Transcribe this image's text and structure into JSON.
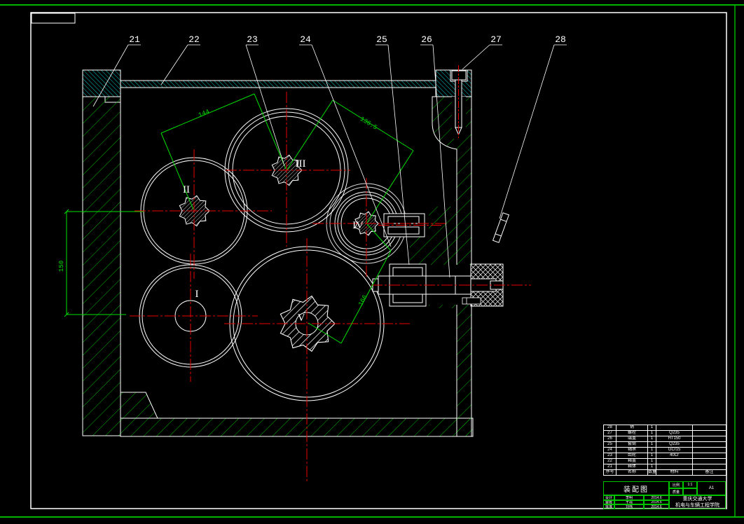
{
  "callouts": [
    "21",
    "22",
    "23",
    "24",
    "25",
    "26",
    "27",
    "28"
  ],
  "shafts": [
    "I",
    "II",
    "III",
    "IV",
    "V"
  ],
  "dimensions": {
    "vertical": "150",
    "upper": "144",
    "middle": "136.5",
    "lower": "166"
  },
  "colors": {
    "hatch_body": "#00b400",
    "hatch_cover": "#00c8c8",
    "centerline": "#e80000",
    "dimension": "#00e000",
    "line": "#ffffff",
    "table_green": "#00c400"
  },
  "bom": {
    "headers": [
      "序号",
      "名称",
      "数量",
      "材料",
      "备注"
    ],
    "rows": [
      [
        "28",
        "销",
        "1",
        "",
        ""
      ],
      [
        "27",
        "螺栓",
        "1",
        "Q235",
        ""
      ],
      [
        "26",
        "端盖",
        "1",
        "HT150",
        ""
      ],
      [
        "25",
        "套筒",
        "1",
        "Q235",
        ""
      ],
      [
        "24",
        "轴承",
        "1",
        "GCr15",
        ""
      ],
      [
        "23",
        "齿轮",
        "1",
        "40Cr",
        ""
      ],
      [
        "22",
        "箱盖",
        "1",
        "",
        ""
      ],
      [
        "21",
        "箱体",
        "1",
        "",
        ""
      ]
    ]
  },
  "title_block": {
    "drawing_title": "装配图",
    "scale_label": "比例",
    "scale_value": "1:1",
    "mass_label": "质量",
    "mass_value": "",
    "sheet_size": "A1",
    "sign_rows": [
      {
        "role": "设计",
        "name": "李明",
        "date": "2014.6"
      },
      {
        "role": "审核",
        "name": "王强",
        "date": "2014.6"
      },
      {
        "role": "批准",
        "name": "刘伟",
        "date": "2014.6"
      }
    ],
    "org_line1": "重庆交通大学",
    "org_line2": "机电与车辆工程学院"
  }
}
